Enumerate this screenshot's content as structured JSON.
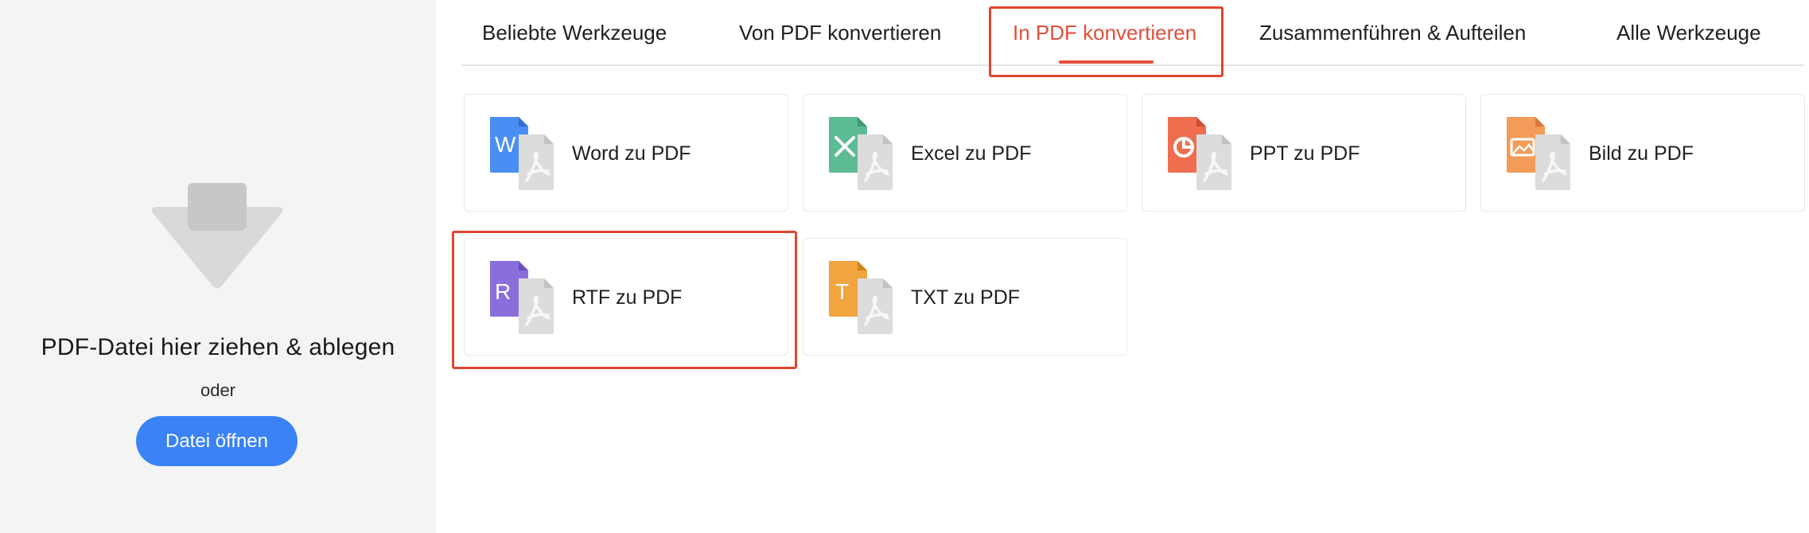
{
  "drop_panel": {
    "title": "PDF-Datei hier ziehen & ablegen",
    "or_text": "oder",
    "open_button": "Datei öffnen",
    "icon": "download-arrow-icon"
  },
  "tabs": [
    {
      "label": "Beliebte Werkzeuge",
      "active": false
    },
    {
      "label": "Von PDF konvertieren",
      "active": false
    },
    {
      "label": "In PDF konvertieren",
      "active": true
    },
    {
      "label": "Zusammenführen & Aufteilen",
      "active": false
    },
    {
      "label": "Alle Werkzeuge",
      "active": false
    }
  ],
  "tools": [
    {
      "label": "Word zu PDF",
      "icon": "word-doc-icon",
      "color": "#4a8ef3",
      "letter": "W"
    },
    {
      "label": "Excel zu PDF",
      "icon": "excel-doc-icon",
      "color": "#5dbb93",
      "letter": "X"
    },
    {
      "label": "PPT zu PDF",
      "icon": "ppt-doc-icon",
      "color": "#ee6e4f",
      "letter": ""
    },
    {
      "label": "Bild zu PDF",
      "icon": "image-doc-icon",
      "color": "#f39c5a",
      "letter": ""
    },
    {
      "label": "RTF zu PDF",
      "icon": "rtf-doc-icon",
      "color": "#8a6fdc",
      "letter": "R"
    },
    {
      "label": "TXT zu PDF",
      "icon": "txt-doc-icon",
      "color": "#f2a43e",
      "letter": "T"
    }
  ],
  "colors": {
    "accent": "#e24e3c",
    "primary_button": "#3a82f6",
    "annotation": "#e0452f"
  }
}
